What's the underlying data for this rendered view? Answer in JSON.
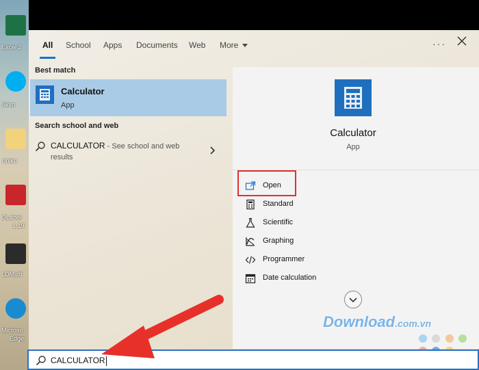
{
  "desktop": {
    "icons": [
      {
        "name": "excel-icon",
        "label": "Excel 2"
      },
      {
        "name": "skype-icon",
        "label": "Skyp"
      },
      {
        "name": "folder-icon",
        "label": "Unike"
      },
      {
        "name": "qlabel-icon",
        "label": "QLabel"
      },
      {
        "name": "qlabel-version",
        "label": "1.19"
      },
      {
        "name": "ldmulti-icon",
        "label": "LDMulti"
      },
      {
        "name": "edge-icon",
        "label": "Microso"
      },
      {
        "name": "edge-label2",
        "label": "Edge"
      }
    ]
  },
  "tabs": [
    {
      "label": "All",
      "active": true
    },
    {
      "label": "School"
    },
    {
      "label": "Apps"
    },
    {
      "label": "Documents"
    },
    {
      "label": "Web"
    },
    {
      "label": "More"
    }
  ],
  "best_match": {
    "heading": "Best match",
    "title": "Calculator",
    "subtitle": "App"
  },
  "web_search": {
    "heading": "Search school and web",
    "query": "CALCULATOR",
    "hint": " - See school and web",
    "hint2": "results"
  },
  "detail": {
    "title": "Calculator",
    "subtitle": "App",
    "actions": [
      {
        "label": "Open",
        "icon": "open-icon"
      },
      {
        "label": "Standard",
        "icon": "calculator-icon"
      },
      {
        "label": "Scientific",
        "icon": "flask-icon"
      },
      {
        "label": "Graphing",
        "icon": "graph-icon"
      },
      {
        "label": "Programmer",
        "icon": "code-icon"
      },
      {
        "label": "Date calculation",
        "icon": "calendar-icon"
      }
    ]
  },
  "watermark": {
    "text": "Download",
    "suffix": ".com.vn",
    "dot_colors": [
      "#a9d4f2",
      "#d9d9d9",
      "#f2c9a0",
      "#b5e0a0",
      "#f0a8a8",
      "#6faee0",
      "#f2d27a"
    ]
  },
  "search": {
    "value": "CALCULATOR"
  },
  "colors": {
    "accent": "#1a73c8",
    "highlight": "#a9cbe6",
    "annotation": "#e0302a"
  }
}
